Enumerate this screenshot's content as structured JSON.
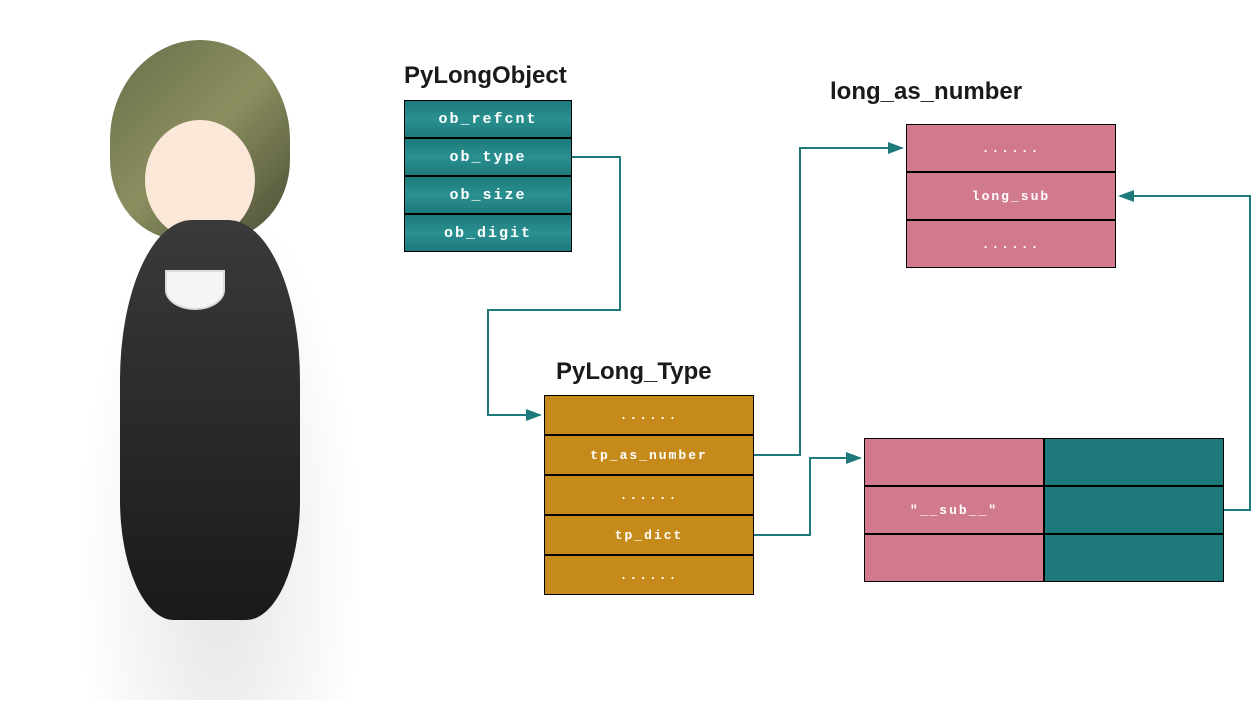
{
  "titles": {
    "pylongobject": "PyLongObject",
    "pylongtype": "PyLong_Type",
    "longasnumber": "long_as_number"
  },
  "pylongobject": {
    "fields": [
      "ob_refcnt",
      "ob_type",
      "ob_size",
      "ob_digit"
    ]
  },
  "pylongtype": {
    "fields": [
      "......",
      "tp_as_number",
      "......",
      "tp_dict",
      "......"
    ]
  },
  "longasnumber": {
    "fields": [
      "......",
      "long_sub",
      "......"
    ]
  },
  "dict": {
    "rows": [
      {
        "key": "",
        "val": ""
      },
      {
        "key": "\"__sub__\"",
        "val": ""
      },
      {
        "key": "",
        "val": ""
      }
    ]
  },
  "colors": {
    "teal": "#1e7a7a",
    "gold": "#c68a1a",
    "pink": "#d17a8e"
  }
}
